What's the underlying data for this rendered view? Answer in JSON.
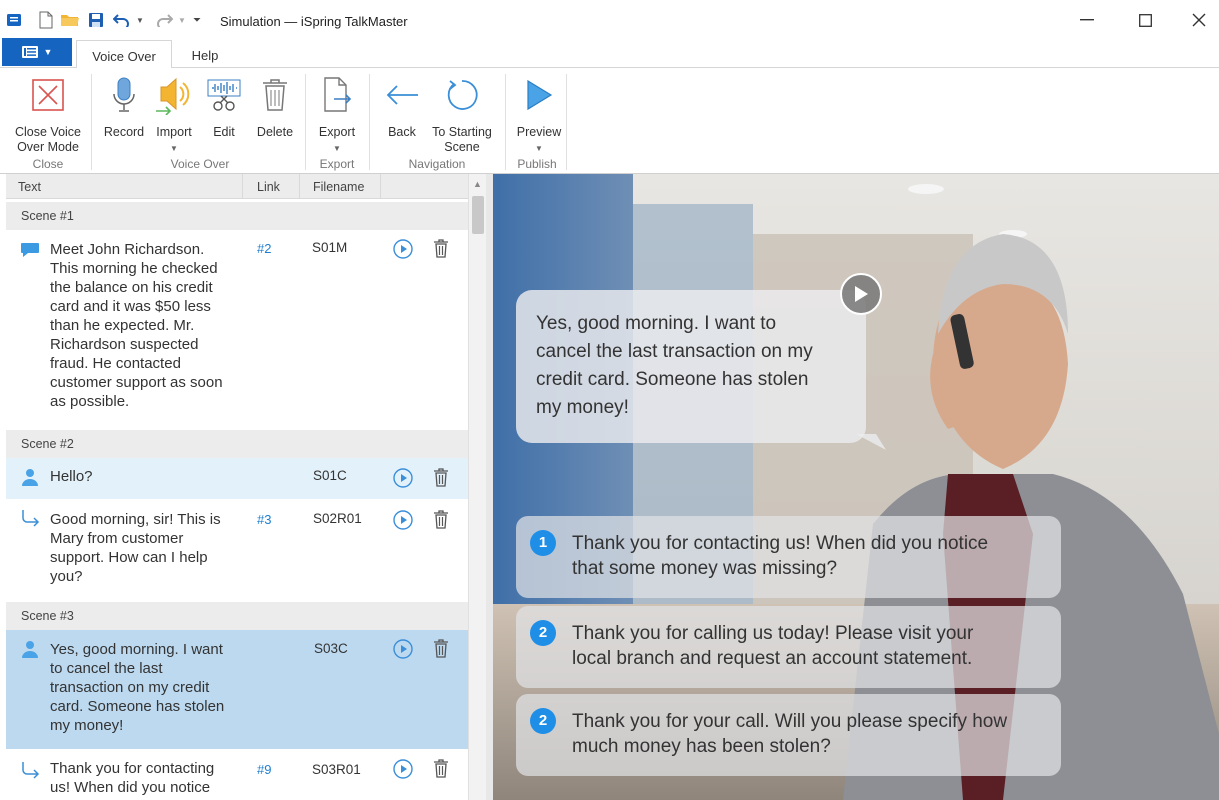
{
  "window": {
    "title": "Simulation — iSpring TalkMaster"
  },
  "tabs": [
    {
      "label": "Voice Over",
      "active": true
    },
    {
      "label": "Help",
      "active": false
    }
  ],
  "ribbon": {
    "buttons": {
      "close_voice_over": "Close Voice\nOver Mode",
      "record": "Record",
      "import": "Import",
      "edit": "Edit",
      "delete": "Delete",
      "export": "Export",
      "back": "Back",
      "to_starting_scene": "To Starting\nScene",
      "preview": "Preview"
    },
    "groups": {
      "close": "Close",
      "voice_over": "Voice Over",
      "export": "Export",
      "navigation": "Navigation",
      "publish": "Publish"
    }
  },
  "table": {
    "columns": {
      "text": "Text",
      "link": "Link",
      "filename": "Filename"
    },
    "scenes": [
      "Scene #1",
      "Scene #2",
      "Scene #3"
    ],
    "rows": [
      {
        "icon": "speech-bubble-icon",
        "text": "Meet John Richardson.\nThis morning he checked\nthe balance on his credit\ncard and it was $50 less\nthan he expected. Mr.\nRichardson suspected\nfraud. He contacted\ncustomer support as soon\nas possible.",
        "link": "#2",
        "filename": "S01M"
      },
      {
        "icon": "person-icon",
        "text": "Hello?",
        "link": "",
        "filename": "S01C"
      },
      {
        "icon": "reply-arrow-icon",
        "text": "Good morning, sir! This is\nMary from customer\nsupport. How can I help\nyou?",
        "link": "#3",
        "filename": "S02R01"
      },
      {
        "icon": "person-icon",
        "text": "Yes, good morning. I want\nto cancel the last\ntransaction on my credit\ncard. Someone has stolen\nmy money!",
        "link": "",
        "filename": "S03C",
        "selected": true
      },
      {
        "icon": "reply-arrow-icon",
        "text": "Thank you for contacting\nus! When did you notice",
        "link": "#9",
        "filename": "S03R01"
      }
    ]
  },
  "preview": {
    "speech": "Yes, good morning. I want to\ncancel the last transaction on my\ncredit card. Someone has stolen\nmy money!",
    "answers": [
      {
        "num": "1",
        "text": "Thank you for contacting us! When did you notice\nthat some money was missing?"
      },
      {
        "num": "2",
        "text": "Thank you for calling us today! Please visit your\nlocal branch and request an account statement."
      },
      {
        "num": "2",
        "text": "Thank you for your call. Will you please specify how\nmuch money has been stolen?"
      }
    ]
  },
  "colors": {
    "accent": "#1565c0",
    "link": "#1e7fd0",
    "selected_row": "#bcd9f0",
    "hover_row": "#e3f1fb",
    "answer_badge": "#1f8ee6"
  }
}
